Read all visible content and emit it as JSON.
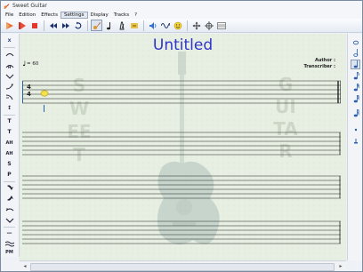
{
  "window": {
    "title": "Sweet Guitar"
  },
  "menu": [
    "File",
    "Edition",
    "Effects",
    "Settings",
    "Display",
    "Tracks",
    "?"
  ],
  "menu_active_index": 3,
  "toolbar": {
    "icons": [
      "record-icon",
      "play-icon",
      "stop-icon",
      "rewind-icon",
      "fast-forward-icon",
      "loop-icon",
      "guitar-icon",
      "note-icon",
      "metronome-icon",
      "mute-icon",
      "speaker-icon",
      "waveform-icon",
      "smiley-icon",
      "move-icon",
      "crosshair-icon",
      "mixer-icon"
    ]
  },
  "left_tools": [
    "x",
    "~",
    "~",
    "/\\",
    "~",
    "↕",
    "T",
    "T",
    "AH",
    "AH",
    "S",
    "P",
    "~",
    "~",
    "~",
    "~",
    "~",
    "—",
    "≈",
    "PM"
  ],
  "document": {
    "title": "Untitled",
    "tempo_value": "= 60",
    "author_label": "Author :",
    "transcriber_label": "Transcriber :",
    "time_signature_top": "4",
    "time_signature_bottom": "4",
    "watermark_left": "SWEET",
    "watermark_right": "GUITAR"
  },
  "colors": {
    "title": "#2f35c8",
    "note_highlight": "#f3e24c",
    "accent": "#2a5db0"
  }
}
